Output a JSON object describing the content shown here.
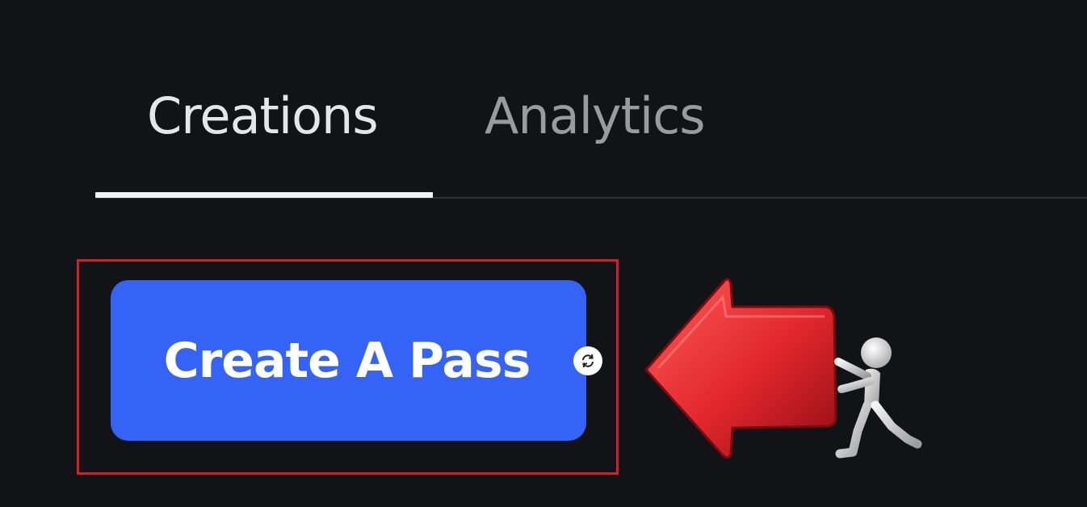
{
  "tabs": {
    "items": [
      {
        "label": "Creations",
        "active": true
      },
      {
        "label": "Analytics",
        "active": false
      }
    ]
  },
  "primary_button": {
    "label": "Create A Pass",
    "color": "#3563f6"
  },
  "annotation": {
    "highlight_color": "#d0202a",
    "arrow_color": "#e0262c",
    "refresh_icon": "refresh-icon"
  }
}
